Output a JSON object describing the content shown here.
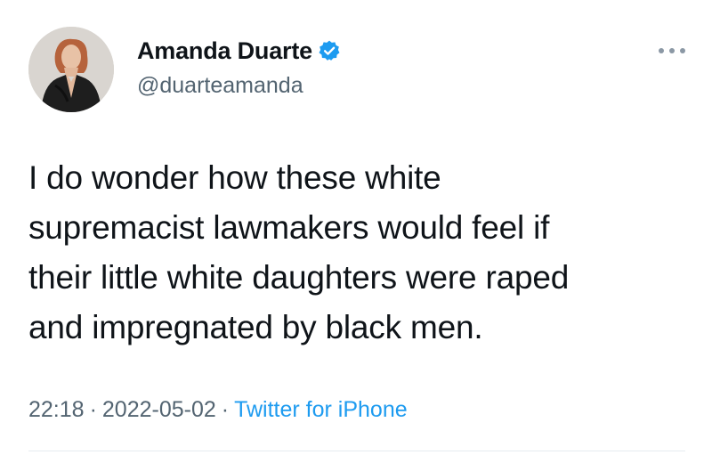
{
  "tweet": {
    "author": {
      "display_name": "Amanda Duarte",
      "handle": "@duarteamanda",
      "verified": true,
      "avatar_icon": "profile-photo"
    },
    "text_lines": [
      "I do wonder how these white",
      "supremacist lawmakers would feel if",
      "their little white daughters were raped",
      "and impregnated by black men."
    ],
    "time": "22:18",
    "date": "2022-05-02",
    "separator": "·",
    "source": "Twitter for iPhone",
    "more_icon": "more-options-icon"
  },
  "colors": {
    "text": "#0f1419",
    "secondary": "#536471",
    "accent": "#1d9bf0",
    "divider": "#e6ecf0"
  }
}
